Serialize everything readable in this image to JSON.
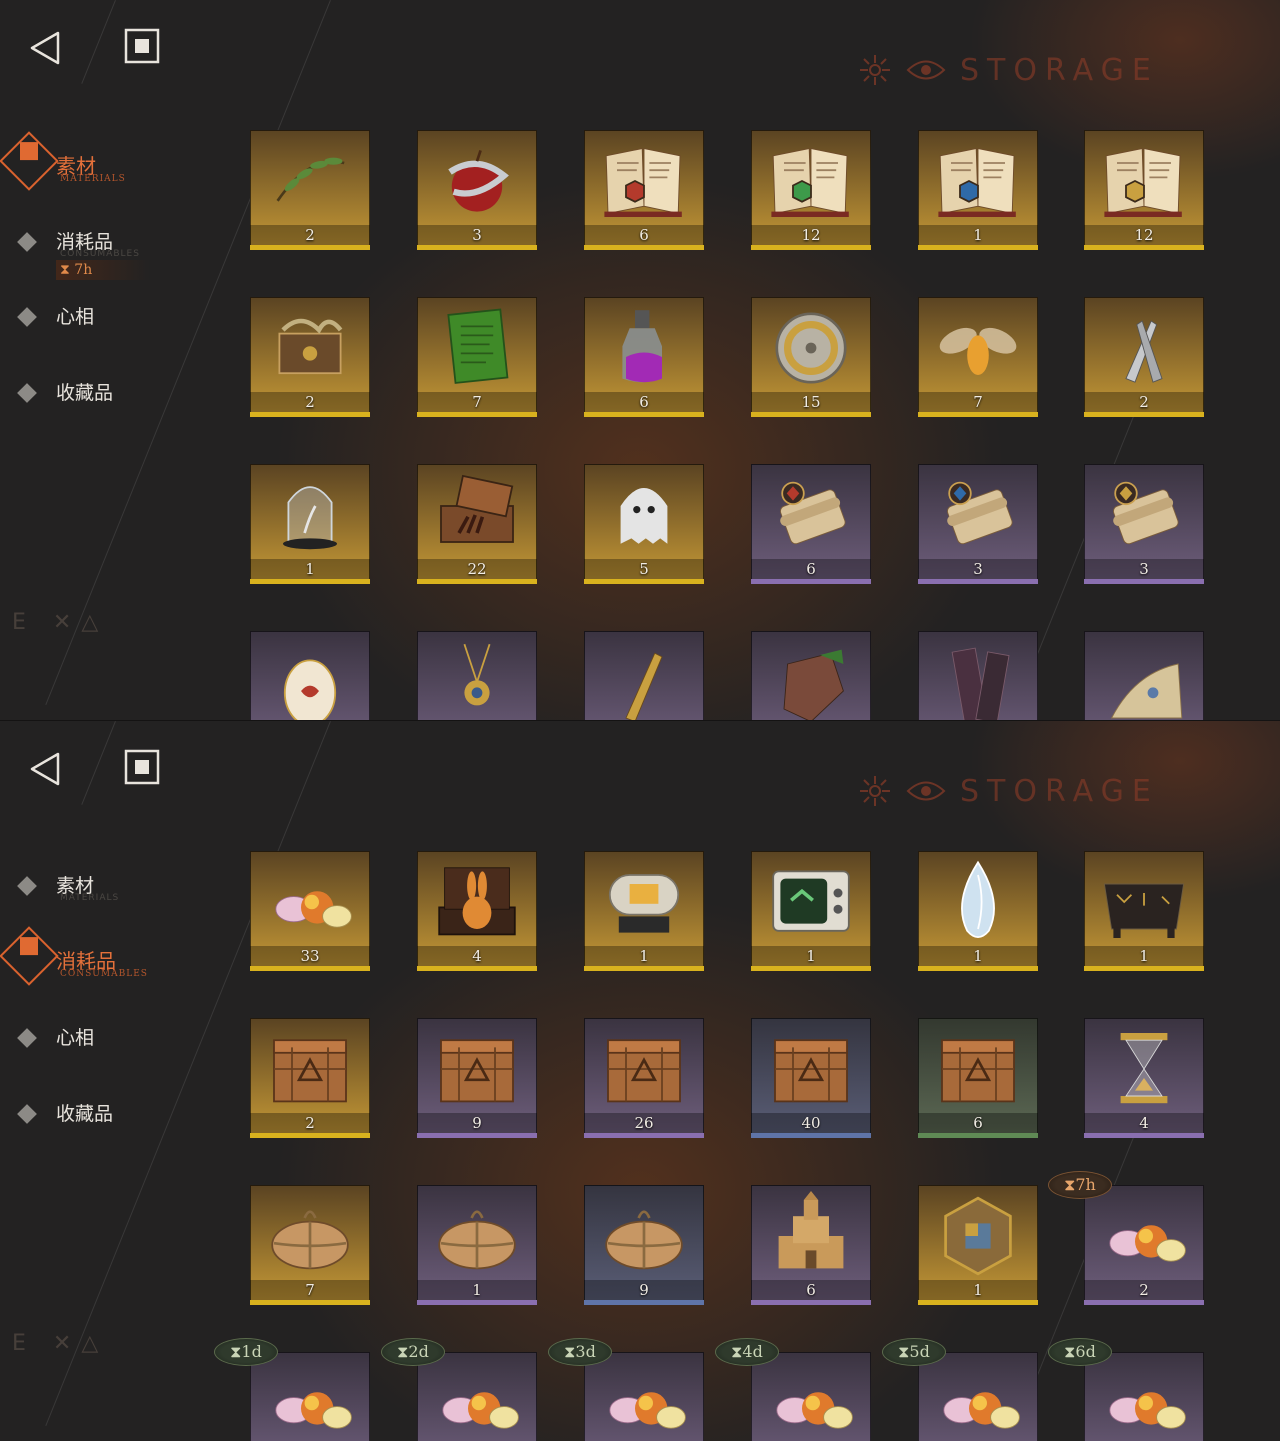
{
  "colors": {
    "gold": "#d9b21e",
    "purple": "#8a6fb0",
    "blue": "#5f74a8",
    "green": "#5f8a55",
    "accent": "#e06a32"
  },
  "top": {
    "header": {
      "title": "STORAGE",
      "subtitle": "",
      "back_icon": "back-triangle-icon",
      "home_icon": "square-home-icon"
    },
    "nav": [
      {
        "label": "素材",
        "sub": "MATERIALS",
        "active": true
      },
      {
        "label": "消耗品",
        "sub": "CONSUMABLES",
        "active": false,
        "timer": "7h"
      },
      {
        "label": "心相",
        "sub": "",
        "active": false
      },
      {
        "label": "收藏品",
        "sub": "",
        "active": false
      }
    ],
    "items": [
      {
        "icon": "olive-branch-icon",
        "count": "2",
        "rarity": "gold"
      },
      {
        "icon": "snake-apple-icon",
        "count": "3",
        "rarity": "gold"
      },
      {
        "icon": "red-rune-book-icon",
        "count": "6",
        "rarity": "gold"
      },
      {
        "icon": "green-rune-book-icon",
        "count": "12",
        "rarity": "gold"
      },
      {
        "icon": "blue-rune-book-icon",
        "count": "1",
        "rarity": "gold"
      },
      {
        "icon": "gold-rune-book-icon",
        "count": "12",
        "rarity": "gold"
      },
      {
        "icon": "root-chest-icon",
        "count": "2",
        "rarity": "gold"
      },
      {
        "icon": "green-tablet-icon",
        "count": "7",
        "rarity": "gold"
      },
      {
        "icon": "potion-bottle-icon",
        "count": "6",
        "rarity": "gold"
      },
      {
        "icon": "brass-device-icon",
        "count": "15",
        "rarity": "gold"
      },
      {
        "icon": "moth-bulb-icon",
        "count": "7",
        "rarity": "gold"
      },
      {
        "icon": "twin-bullets-icon",
        "count": "2",
        "rarity": "gold"
      },
      {
        "icon": "bell-jar-icon",
        "count": "1",
        "rarity": "gold"
      },
      {
        "icon": "hand-case-icon",
        "count": "22",
        "rarity": "gold"
      },
      {
        "icon": "ghost-icon",
        "count": "5",
        "rarity": "gold"
      },
      {
        "icon": "red-scroll-icon",
        "count": "6",
        "rarity": "purple"
      },
      {
        "icon": "blue-scroll-icon",
        "count": "3",
        "rarity": "purple"
      },
      {
        "icon": "gold-scroll-icon",
        "count": "3",
        "rarity": "purple"
      },
      {
        "icon": "ornate-egg-icon",
        "count": "",
        "rarity": "purple"
      },
      {
        "icon": "pendant-icon",
        "count": "",
        "rarity": "purple"
      },
      {
        "icon": "gold-tool-icon",
        "count": "",
        "rarity": "purple"
      },
      {
        "icon": "stone-shard-icon",
        "count": "",
        "rarity": "purple"
      },
      {
        "icon": "frame-icon",
        "count": "",
        "rarity": "purple"
      },
      {
        "icon": "cloth-icon",
        "count": "",
        "rarity": "purple"
      }
    ]
  },
  "bottom": {
    "header": {
      "title": "STORAGE",
      "subtitle": "",
      "back_icon": "back-triangle-icon",
      "home_icon": "square-home-icon"
    },
    "nav": [
      {
        "label": "素材",
        "sub": "MATERIALS",
        "active": false
      },
      {
        "label": "消耗品",
        "sub": "CONSUMABLES",
        "active": true
      },
      {
        "label": "心相",
        "sub": "",
        "active": false
      },
      {
        "label": "收藏品",
        "sub": "",
        "active": false
      }
    ],
    "items": [
      {
        "icon": "candy-jar-icon",
        "count": "33",
        "rarity": "gold"
      },
      {
        "icon": "rabbit-box-icon",
        "count": "4",
        "rarity": "gold"
      },
      {
        "icon": "capsule-machine-icon",
        "count": "1",
        "rarity": "gold"
      },
      {
        "icon": "television-icon",
        "count": "1",
        "rarity": "gold"
      },
      {
        "icon": "crystal-drop-icon",
        "count": "1",
        "rarity": "gold"
      },
      {
        "icon": "rune-stool-icon",
        "count": "1",
        "rarity": "gold"
      },
      {
        "icon": "crate-gold-icon",
        "count": "2",
        "rarity": "gold"
      },
      {
        "icon": "crate-purple-icon",
        "count": "9",
        "rarity": "purple"
      },
      {
        "icon": "crate-blue-icon",
        "count": "26",
        "rarity": "purple"
      },
      {
        "icon": "crate-steel-icon",
        "count": "40",
        "rarity": "blue"
      },
      {
        "icon": "crate-green-icon",
        "count": "6",
        "rarity": "green"
      },
      {
        "icon": "hourglass-icon",
        "count": "4",
        "rarity": "purple"
      },
      {
        "icon": "parcel-icon",
        "count": "7",
        "rarity": "gold"
      },
      {
        "icon": "parcel-icon",
        "count": "1",
        "rarity": "purple"
      },
      {
        "icon": "parcel-icon",
        "count": "9",
        "rarity": "blue"
      },
      {
        "icon": "sand-castle-icon",
        "count": "6",
        "rarity": "purple"
      },
      {
        "icon": "puzzle-cube-icon",
        "count": "1",
        "rarity": "gold"
      },
      {
        "icon": "candy-pile-icon",
        "count": "2",
        "rarity": "purple",
        "timer": "7h",
        "timer_color": "orange"
      },
      {
        "icon": "candy-pile-icon",
        "count": "",
        "rarity": "purple",
        "timer": "1d",
        "timer_color": "green"
      },
      {
        "icon": "candy-pile-icon",
        "count": "",
        "rarity": "purple",
        "timer": "2d",
        "timer_color": "green"
      },
      {
        "icon": "candy-pile-icon",
        "count": "",
        "rarity": "purple",
        "timer": "3d",
        "timer_color": "green"
      },
      {
        "icon": "candy-pile-icon",
        "count": "",
        "rarity": "purple",
        "timer": "4d",
        "timer_color": "green"
      },
      {
        "icon": "candy-pile-icon",
        "count": "",
        "rarity": "purple",
        "timer": "5d",
        "timer_color": "green"
      },
      {
        "icon": "candy-pile-icon",
        "count": "",
        "rarity": "purple",
        "timer": "6d",
        "timer_color": "green"
      }
    ]
  }
}
